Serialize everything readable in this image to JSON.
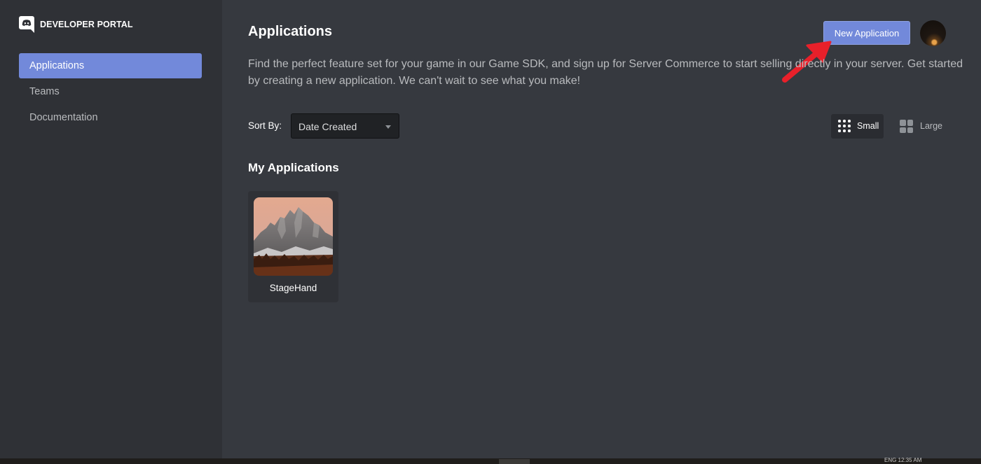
{
  "sidebar": {
    "brand": "DEVELOPER PORTAL",
    "brand_icon": "discord-logo-icon",
    "items": [
      {
        "label": "Applications",
        "active": true
      },
      {
        "label": "Teams",
        "active": false
      },
      {
        "label": "Documentation",
        "active": false
      }
    ]
  },
  "main": {
    "title": "Applications",
    "new_button_label": "New Application",
    "description": "Find the perfect feature set for your game in our Game SDK, and sign up for Server Commerce to start selling directly in your server. Get started by creating a new application. We can't wait to see what you make!",
    "sort": {
      "label": "Sort By:",
      "value": "Date Created"
    },
    "view_toggle": {
      "small_label": "Small",
      "large_label": "Large",
      "selected": "Small"
    },
    "section_title": "My Applications",
    "apps": [
      {
        "name": "StageHand",
        "icon": "mountain-photo-icon"
      }
    ]
  },
  "taskbar": {
    "clock": "ENG 12:35 AM"
  },
  "colors": {
    "accent": "#7289da",
    "sidebar_bg": "#2f3136",
    "main_bg": "#36393f",
    "annotation_arrow": "#e8202a"
  }
}
